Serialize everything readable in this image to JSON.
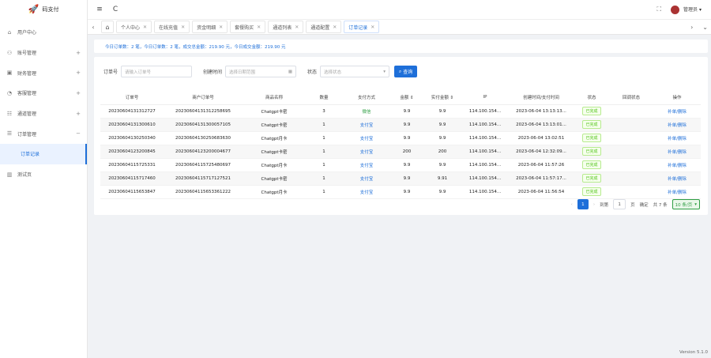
{
  "app": {
    "logo_text": "码支付"
  },
  "sidebar": {
    "items": [
      {
        "icon": "home-icon",
        "label": "用户中心",
        "arrow": ""
      },
      {
        "icon": "user-icon",
        "label": "账号管理",
        "arrow": "+"
      },
      {
        "icon": "wallet-icon",
        "label": "财务管理",
        "arrow": "+"
      },
      {
        "icon": "bell-icon",
        "label": "客服管理",
        "arrow": "+"
      },
      {
        "icon": "channel-icon",
        "label": "通道管理",
        "arrow": "+"
      },
      {
        "icon": "order-icon",
        "label": "订单管理",
        "arrow": "−"
      }
    ],
    "sub_active": "订单记录",
    "extra": {
      "icon": "chart-icon",
      "label": "测试页"
    }
  },
  "topbar": {
    "menu_icon": "≡",
    "refresh_icon": "C",
    "fullscreen_icon": "⛶",
    "user_name": "管理员",
    "user_caret": "▾"
  },
  "tabs": {
    "prev": "‹",
    "items": [
      {
        "label": "个人中心"
      },
      {
        "label": "在线充值"
      },
      {
        "label": "资金明细"
      },
      {
        "label": "套餐购买"
      },
      {
        "label": "通道列表"
      },
      {
        "label": "通道配置"
      },
      {
        "label": "订单记录"
      }
    ],
    "next": "›",
    "more": "⌄"
  },
  "notice": {
    "text": "今日订单数：2 笔，今日订单数：2 笔，成交总金额：219.90 元，今日成交金额：219.90 元"
  },
  "search": {
    "order_label": "订单号",
    "order_placeholder": "请输入订单号",
    "time_label": "创建时间",
    "time_placeholder": "选择日期范围",
    "status_label": "状态",
    "status_placeholder": "选择状态",
    "button": "查询"
  },
  "table": {
    "headers": [
      "订单号",
      "商户订单号",
      "商品名称",
      "数量",
      "支付方式",
      "金额 ⇕",
      "实付金额 ⇕",
      "IP",
      "创建时间/支付时间",
      "状态",
      "回调状态",
      "操作"
    ],
    "rows": [
      [
        "20230604131312727",
        "20230604131312258695",
        "Chatgpt卡密",
        "3",
        "微信",
        "9.9",
        "9.9",
        "114.100.154...",
        "2023-06-04 13:13:13...",
        "已完成",
        "",
        "补单/删除"
      ],
      [
        "20230604131300610",
        "20230604131300057105",
        "Chatgpt卡密",
        "1",
        "支付宝",
        "9.9",
        "9.9",
        "114.100.154...",
        "2023-06-04 13:13:01...",
        "已完成",
        "",
        "补单/删除"
      ],
      [
        "20230604130250340",
        "20230604130250683630",
        "Chatgpt月卡",
        "1",
        "支付宝",
        "9.9",
        "9.9",
        "114.100.154...",
        "2023-06-04 13:02:51",
        "已完成",
        "",
        "补单/删除"
      ],
      [
        "20230604123200845",
        "20230604123200004677",
        "Chatgpt卡密",
        "1",
        "支付宝",
        "200",
        "200",
        "114.100.154...",
        "2023-06-04 12:32:09...",
        "已完成",
        "",
        "补单/删除"
      ],
      [
        "20230604115725331",
        "20230604115725480697",
        "Chatgpt月卡",
        "1",
        "支付宝",
        "9.9",
        "9.9",
        "114.100.154...",
        "2023-06-04 11:57:26",
        "已完成",
        "",
        "补单/删除"
      ],
      [
        "20230604115717460",
        "20230604115717127521",
        "Chatgpt卡密",
        "1",
        "支付宝",
        "9.9",
        "9.91",
        "114.100.154...",
        "2023-06-04 11:57:17...",
        "已完成",
        "",
        "补单/删除"
      ],
      [
        "20230604115653847",
        "20230604115653361222",
        "Chatgpt月卡",
        "1",
        "支付宝",
        "9.9",
        "9.9",
        "114.100.154...",
        "2023-06-04 11:56:54",
        "已完成",
        "",
        "补单/删除"
      ]
    ]
  },
  "pager": {
    "prev": "‹",
    "current": "1",
    "next": "›",
    "goto_label": "到第",
    "goto_value": "1",
    "page_unit": "页",
    "confirm": "确定",
    "total": "共 7 条",
    "page_size": "10 条/页"
  },
  "footer": {
    "version": "Version 5.1.0"
  },
  "colors": {
    "accent": "#1e6fd9",
    "success": "#52c41a"
  }
}
